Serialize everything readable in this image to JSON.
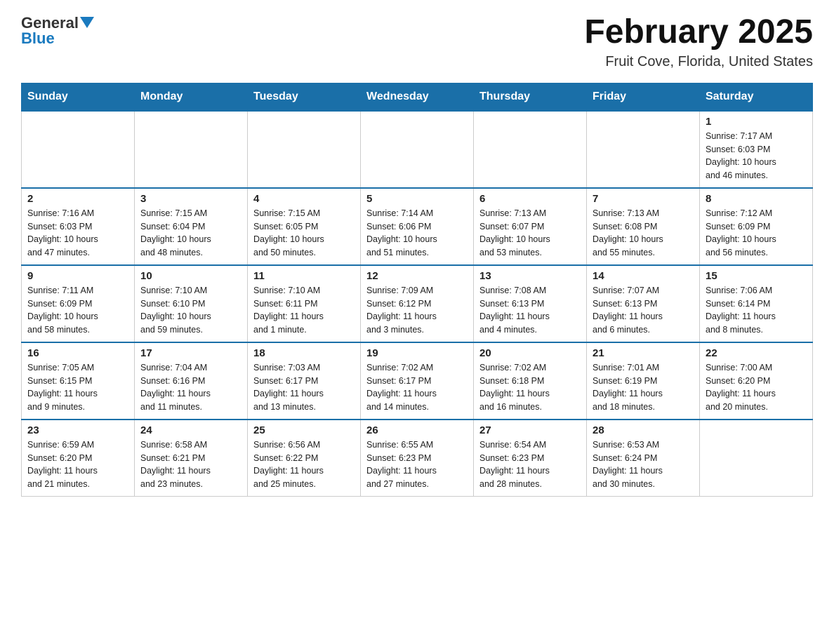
{
  "header": {
    "logo_general": "General",
    "logo_blue": "Blue",
    "month_title": "February 2025",
    "location": "Fruit Cove, Florida, United States"
  },
  "weekdays": [
    "Sunday",
    "Monday",
    "Tuesday",
    "Wednesday",
    "Thursday",
    "Friday",
    "Saturday"
  ],
  "weeks": [
    [
      {
        "day": "",
        "info": ""
      },
      {
        "day": "",
        "info": ""
      },
      {
        "day": "",
        "info": ""
      },
      {
        "day": "",
        "info": ""
      },
      {
        "day": "",
        "info": ""
      },
      {
        "day": "",
        "info": ""
      },
      {
        "day": "1",
        "info": "Sunrise: 7:17 AM\nSunset: 6:03 PM\nDaylight: 10 hours\nand 46 minutes."
      }
    ],
    [
      {
        "day": "2",
        "info": "Sunrise: 7:16 AM\nSunset: 6:03 PM\nDaylight: 10 hours\nand 47 minutes."
      },
      {
        "day": "3",
        "info": "Sunrise: 7:15 AM\nSunset: 6:04 PM\nDaylight: 10 hours\nand 48 minutes."
      },
      {
        "day": "4",
        "info": "Sunrise: 7:15 AM\nSunset: 6:05 PM\nDaylight: 10 hours\nand 50 minutes."
      },
      {
        "day": "5",
        "info": "Sunrise: 7:14 AM\nSunset: 6:06 PM\nDaylight: 10 hours\nand 51 minutes."
      },
      {
        "day": "6",
        "info": "Sunrise: 7:13 AM\nSunset: 6:07 PM\nDaylight: 10 hours\nand 53 minutes."
      },
      {
        "day": "7",
        "info": "Sunrise: 7:13 AM\nSunset: 6:08 PM\nDaylight: 10 hours\nand 55 minutes."
      },
      {
        "day": "8",
        "info": "Sunrise: 7:12 AM\nSunset: 6:09 PM\nDaylight: 10 hours\nand 56 minutes."
      }
    ],
    [
      {
        "day": "9",
        "info": "Sunrise: 7:11 AM\nSunset: 6:09 PM\nDaylight: 10 hours\nand 58 minutes."
      },
      {
        "day": "10",
        "info": "Sunrise: 7:10 AM\nSunset: 6:10 PM\nDaylight: 10 hours\nand 59 minutes."
      },
      {
        "day": "11",
        "info": "Sunrise: 7:10 AM\nSunset: 6:11 PM\nDaylight: 11 hours\nand 1 minute."
      },
      {
        "day": "12",
        "info": "Sunrise: 7:09 AM\nSunset: 6:12 PM\nDaylight: 11 hours\nand 3 minutes."
      },
      {
        "day": "13",
        "info": "Sunrise: 7:08 AM\nSunset: 6:13 PM\nDaylight: 11 hours\nand 4 minutes."
      },
      {
        "day": "14",
        "info": "Sunrise: 7:07 AM\nSunset: 6:13 PM\nDaylight: 11 hours\nand 6 minutes."
      },
      {
        "day": "15",
        "info": "Sunrise: 7:06 AM\nSunset: 6:14 PM\nDaylight: 11 hours\nand 8 minutes."
      }
    ],
    [
      {
        "day": "16",
        "info": "Sunrise: 7:05 AM\nSunset: 6:15 PM\nDaylight: 11 hours\nand 9 minutes."
      },
      {
        "day": "17",
        "info": "Sunrise: 7:04 AM\nSunset: 6:16 PM\nDaylight: 11 hours\nand 11 minutes."
      },
      {
        "day": "18",
        "info": "Sunrise: 7:03 AM\nSunset: 6:17 PM\nDaylight: 11 hours\nand 13 minutes."
      },
      {
        "day": "19",
        "info": "Sunrise: 7:02 AM\nSunset: 6:17 PM\nDaylight: 11 hours\nand 14 minutes."
      },
      {
        "day": "20",
        "info": "Sunrise: 7:02 AM\nSunset: 6:18 PM\nDaylight: 11 hours\nand 16 minutes."
      },
      {
        "day": "21",
        "info": "Sunrise: 7:01 AM\nSunset: 6:19 PM\nDaylight: 11 hours\nand 18 minutes."
      },
      {
        "day": "22",
        "info": "Sunrise: 7:00 AM\nSunset: 6:20 PM\nDaylight: 11 hours\nand 20 minutes."
      }
    ],
    [
      {
        "day": "23",
        "info": "Sunrise: 6:59 AM\nSunset: 6:20 PM\nDaylight: 11 hours\nand 21 minutes."
      },
      {
        "day": "24",
        "info": "Sunrise: 6:58 AM\nSunset: 6:21 PM\nDaylight: 11 hours\nand 23 minutes."
      },
      {
        "day": "25",
        "info": "Sunrise: 6:56 AM\nSunset: 6:22 PM\nDaylight: 11 hours\nand 25 minutes."
      },
      {
        "day": "26",
        "info": "Sunrise: 6:55 AM\nSunset: 6:23 PM\nDaylight: 11 hours\nand 27 minutes."
      },
      {
        "day": "27",
        "info": "Sunrise: 6:54 AM\nSunset: 6:23 PM\nDaylight: 11 hours\nand 28 minutes."
      },
      {
        "day": "28",
        "info": "Sunrise: 6:53 AM\nSunset: 6:24 PM\nDaylight: 11 hours\nand 30 minutes."
      },
      {
        "day": "",
        "info": ""
      }
    ]
  ]
}
